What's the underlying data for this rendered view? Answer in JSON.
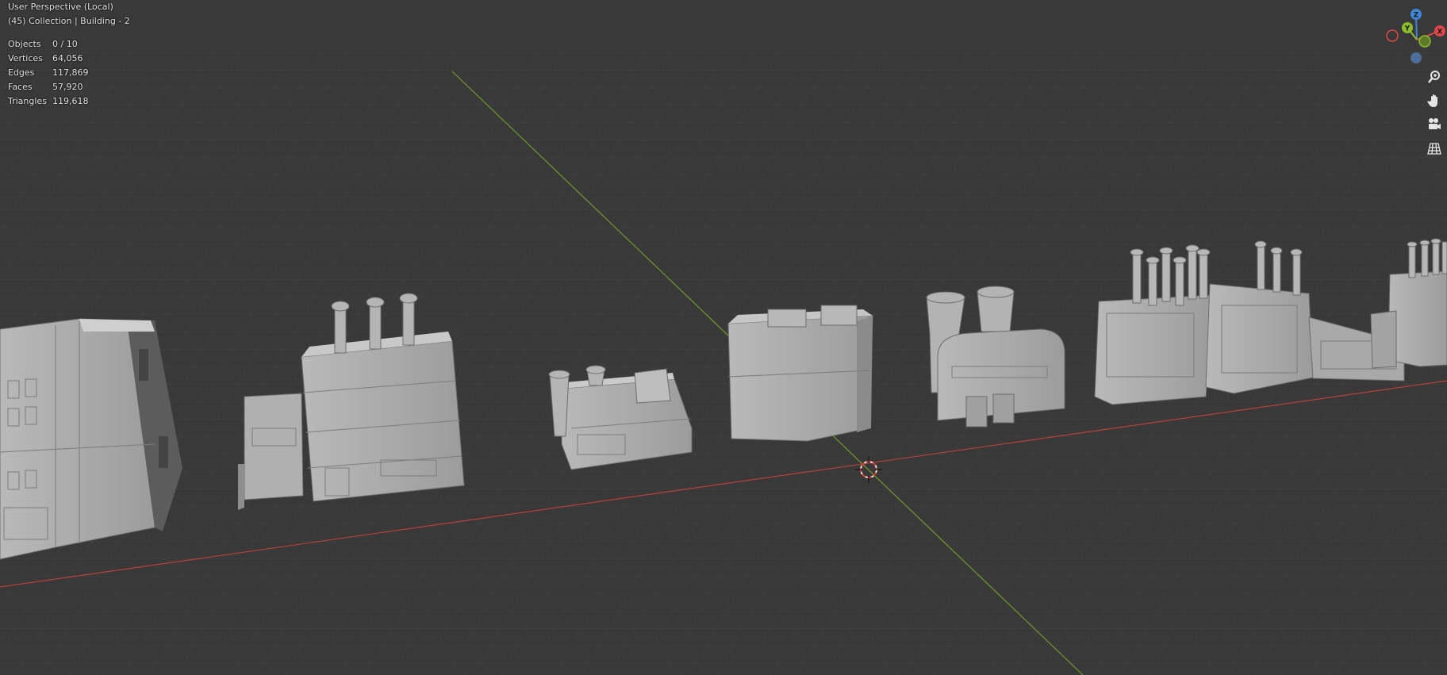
{
  "viewport": {
    "view_name": "User Perspective (Local)",
    "collection": "(45) Collection | Building - 2",
    "stats": [
      {
        "label": "Objects",
        "value": "0 / 10"
      },
      {
        "label": "Vertices",
        "value": "64,056"
      },
      {
        "label": "Edges",
        "value": "117,869"
      },
      {
        "label": "Faces",
        "value": "57,920"
      },
      {
        "label": "Triangles",
        "value": "119,618"
      }
    ]
  },
  "gizmo": {
    "axes": {
      "x": "X",
      "y": "Y",
      "z": "Z"
    },
    "colors": {
      "x": "#e0464a",
      "y": "#8bbf2a",
      "z": "#3d86d8",
      "neg": "#4e6d9a"
    }
  },
  "nav_buttons": [
    {
      "name": "zoom-button",
      "icon": "zoom-icon"
    },
    {
      "name": "pan-button",
      "icon": "hand-icon"
    },
    {
      "name": "camera-view-button",
      "icon": "camera-icon"
    },
    {
      "name": "perspective-toggle-button",
      "icon": "grid-icon"
    }
  ],
  "colors": {
    "background": "#393939",
    "grid": "#434343",
    "x_axis": "#b8403e",
    "y_axis": "#6f9a2c",
    "model": "#a9a9a9"
  }
}
